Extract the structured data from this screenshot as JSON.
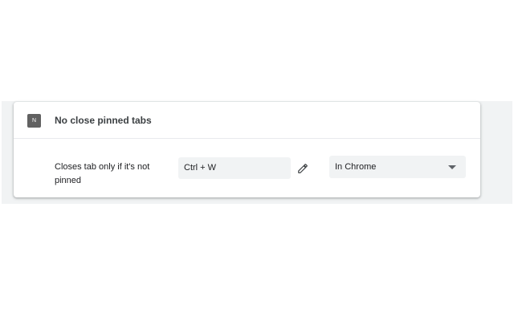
{
  "extension": {
    "icon_letter": "N",
    "icon_name": "extension-icon",
    "name": "No close pinned tabs"
  },
  "command": {
    "description": "Closes tab only if it's not pinned",
    "shortcut": "Ctrl + W",
    "edit_icon": "pencil-icon",
    "scope": "In Chrome",
    "scope_icon": "chevron-down-icon"
  },
  "colors": {
    "page_background": "#f1f3f4",
    "card_background": "#ffffff",
    "icon_background": "#616161",
    "field_background": "#f1f3f4",
    "text_primary": "#202124",
    "icon_gray": "#5f6368"
  }
}
